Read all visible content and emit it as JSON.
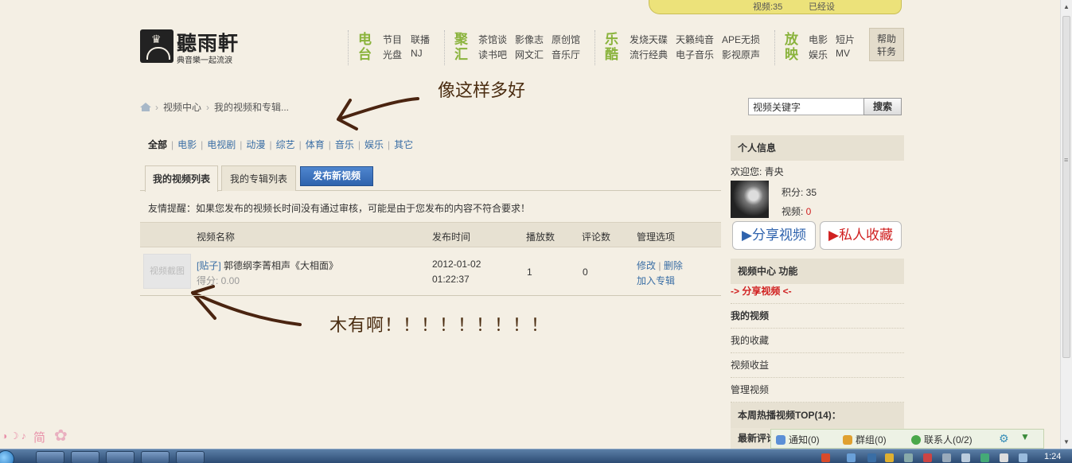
{
  "top_banner": {
    "left_text": "视频:35",
    "right_text": "已经设"
  },
  "logo": {
    "title": "聽雨軒",
    "subtitle": "典音樂一起流淚"
  },
  "nav": [
    {
      "category": "电台",
      "links": [
        "节目",
        "联播",
        "光盘",
        "NJ"
      ]
    },
    {
      "category": "聚汇",
      "links": [
        "茶馆谈",
        "影像志",
        "原创馆",
        "读书吧",
        "网文汇",
        "音乐厅"
      ]
    },
    {
      "category": "乐酷",
      "links": [
        "发烧天碟",
        "天籁纯音",
        "APE无损",
        "流行经典",
        "电子音乐",
        "影视原声"
      ]
    },
    {
      "category": "放映",
      "links": [
        "电影",
        "短片",
        "娱乐",
        "MV"
      ]
    }
  ],
  "help": {
    "line1": "帮助",
    "line2": "轩务"
  },
  "breadcrumb": {
    "item1": "视频中心",
    "item2": "我的视频和专辑..."
  },
  "annotations": {
    "note1": "像这样多好",
    "note2": "木有啊！！！！！！！！！"
  },
  "search": {
    "value": "视频关键字",
    "button": "搜索"
  },
  "categories": [
    "全部",
    "电影",
    "电视剧",
    "动漫",
    "综艺",
    "体育",
    "音乐",
    "娱乐",
    "其它"
  ],
  "tabs": {
    "my_videos": "我的视频列表",
    "my_albums": "我的专辑列表",
    "publish": "发布新视频"
  },
  "notice": "友情提醒：如果您发布的视频长时间没有通过审核，可能是由于您发布的内容不符合要求！",
  "table": {
    "headers": [
      "视频名称",
      "发布时间",
      "播放数",
      "评论数",
      "管理选项"
    ],
    "rows": [
      {
        "thumb_text": "视频截图",
        "tag": "[贴子]",
        "title": "郭德纲李菁相声《大相面》",
        "score": "得分: 0.00",
        "date": "2012-01-02",
        "time": "01:22:37",
        "plays": "1",
        "comments": "0",
        "edit": "修改",
        "delete": "删除",
        "add_album": "加入专辑"
      }
    ]
  },
  "sidebar": {
    "profile_title": "个人信息",
    "welcome": "欢迎您: 青央",
    "points_label": "积分: 35",
    "videos_label": "视频: ",
    "videos_count": "0",
    "share_btn": "▶分享视频",
    "fav_btn": "▶私人收藏",
    "func_title": "视频中心 功能",
    "share_link": "-> 分享视频 <-",
    "items": [
      "我的视频",
      "我的收藏",
      "视频收益",
      "管理视频"
    ],
    "top_title": "本周热播视频TOP(14)：",
    "latest_title": "最新评论"
  },
  "qq_bar": {
    "notify": "通知(0)",
    "group": "群组(0)",
    "contacts": "联系人(0/2)"
  },
  "ime": {
    "label": "简"
  },
  "clock": "1:24",
  "colors": {
    "accent_green": "#8ab33c",
    "link_blue": "#3a6ea5",
    "publish_blue": "#2f63ad",
    "background": "#f4efe4",
    "alert_red": "#d02020"
  }
}
